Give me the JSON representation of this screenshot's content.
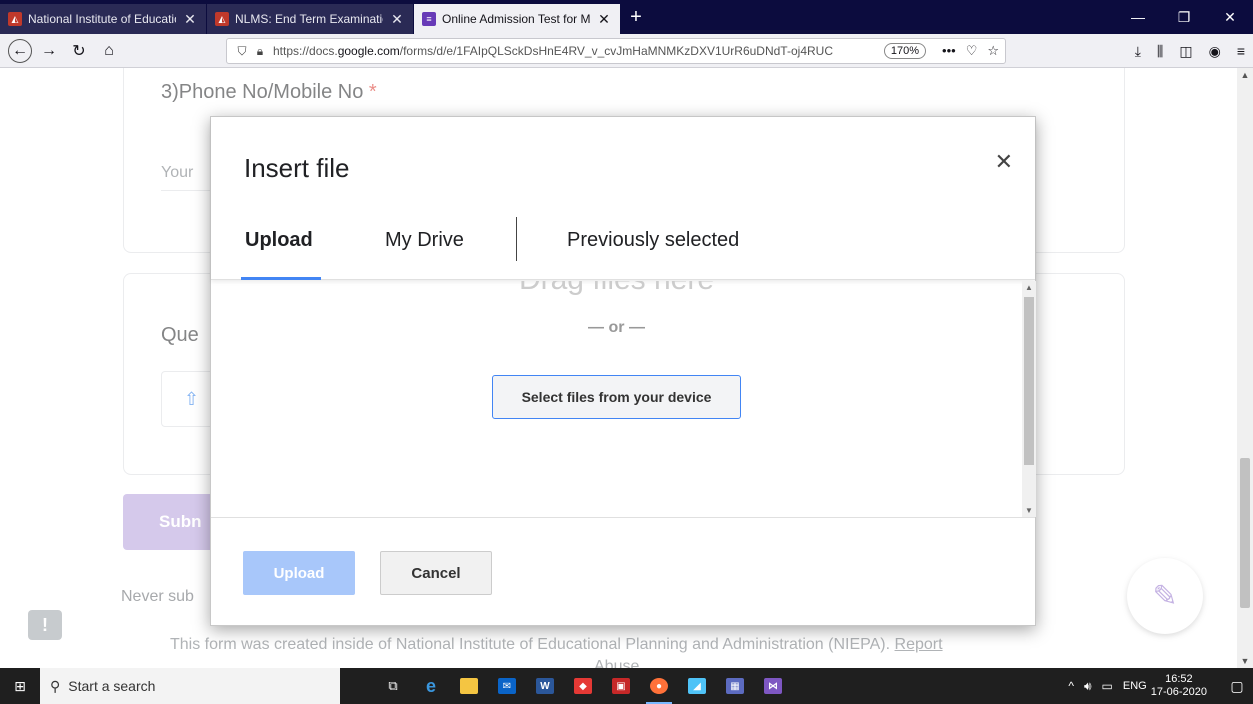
{
  "browser": {
    "tabs": [
      {
        "title": "National Institute of Educationa",
        "favicon": "niepa-icon"
      },
      {
        "title": "NLMS: End Term Examinations",
        "favicon": "niepa-icon"
      },
      {
        "title": "Online Admission Test for M.Ph",
        "favicon": "forms-icon"
      }
    ],
    "url_prefix": "https://docs.",
    "url_domain": "google.com",
    "url_rest": "/forms/d/e/1FAIpQLSckDsHnE4RV_v_cvJmHaMNMKzDXV1UrR6uDNdT-oj4RUC",
    "zoom": "170%"
  },
  "form": {
    "question3_title": "3)Phone No/Mobile No",
    "required_mark": "*",
    "short_answer_placeholder": "Your",
    "question_next_title": "Que",
    "submit_label": "Subn",
    "never_submit": "Never sub",
    "footer_text": "This form was created inside of National Institute of Educational Planning and Administration (NIEPA).",
    "footer_link": "Report",
    "footer_link_2": "Abuse",
    "feedback_label": "!"
  },
  "dialog": {
    "title": "Insert file",
    "tabs": [
      "Upload",
      "My Drive",
      "Previously selected"
    ],
    "drag_text": "Drag files here",
    "or_text": "— or —",
    "select_button": "Select files from your device",
    "upload_button": "Upload",
    "cancel_button": "Cancel"
  },
  "taskbar": {
    "search_placeholder": "Start a search",
    "language": "ENG",
    "time": "16:52",
    "date": "17-06-2020"
  }
}
